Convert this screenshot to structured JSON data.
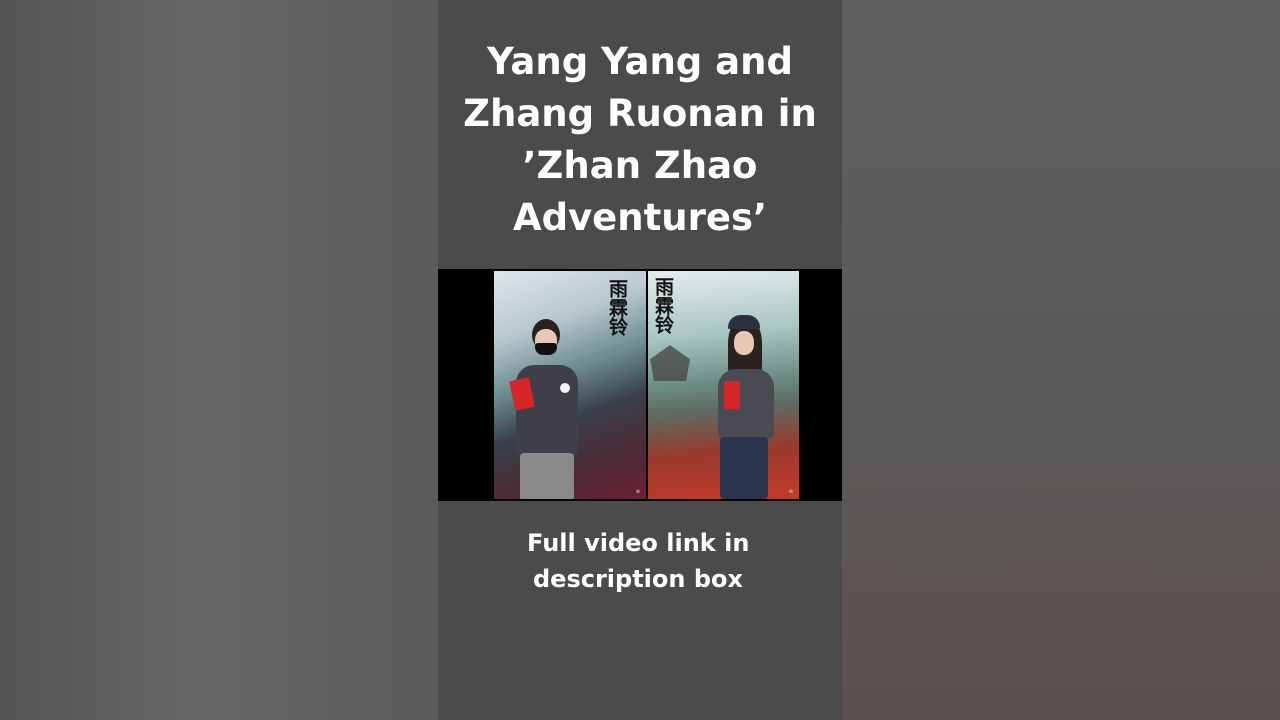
{
  "title": {
    "lines": [
      "Yang Yang and",
      "Zhang Ruonan in",
      "’Zhan Zhao",
      "Adventures’"
    ]
  },
  "poster": {
    "calligraphy_left": "雨霖铃",
    "calligraphy_right": "雨霖铃"
  },
  "caption": {
    "lines": [
      "Full video link in",
      "description box"
    ]
  },
  "colors": {
    "panel": "#4b4b4b",
    "text": "#ffffff",
    "card_red": "#d6262a"
  }
}
